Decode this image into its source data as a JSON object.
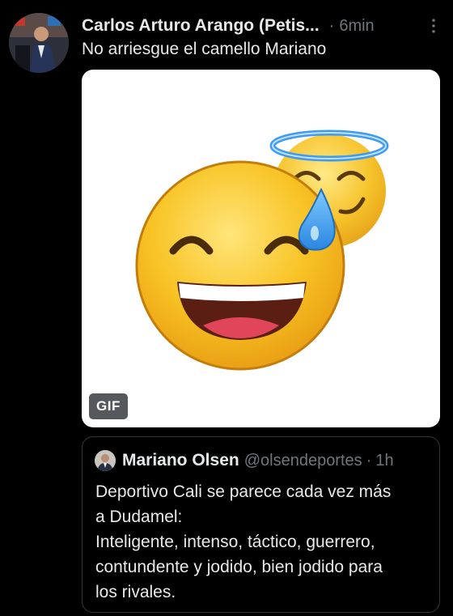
{
  "tweet": {
    "author_name": "Carlos Arturo Arango (Petis...",
    "separator": "·",
    "time": "6min",
    "text": "No arriesgue el camello Mariano",
    "media": {
      "type": "gif",
      "badge_label": "GIF",
      "description_icon": "sweat-smile-emoji-with-halo-emoji"
    }
  },
  "quoted_tweet": {
    "author_name": "Mariano Olsen",
    "handle": "@olsendeportes",
    "separator": "·",
    "time": "1h",
    "text_lines": [
      "Deportivo Cali se parece cada vez más",
      "a Dudamel:",
      "Inteligente, intenso, táctico, guerrero,",
      "contundente y jodido, bien jodido para",
      "los rivales."
    ]
  },
  "colors": {
    "background": "#000000",
    "primary_text": "#e7e9ea",
    "secondary_text": "#71767b",
    "border": "#333639",
    "emoji_yellow": "#f9c02a",
    "halo_blue": "#4aa3ff"
  }
}
